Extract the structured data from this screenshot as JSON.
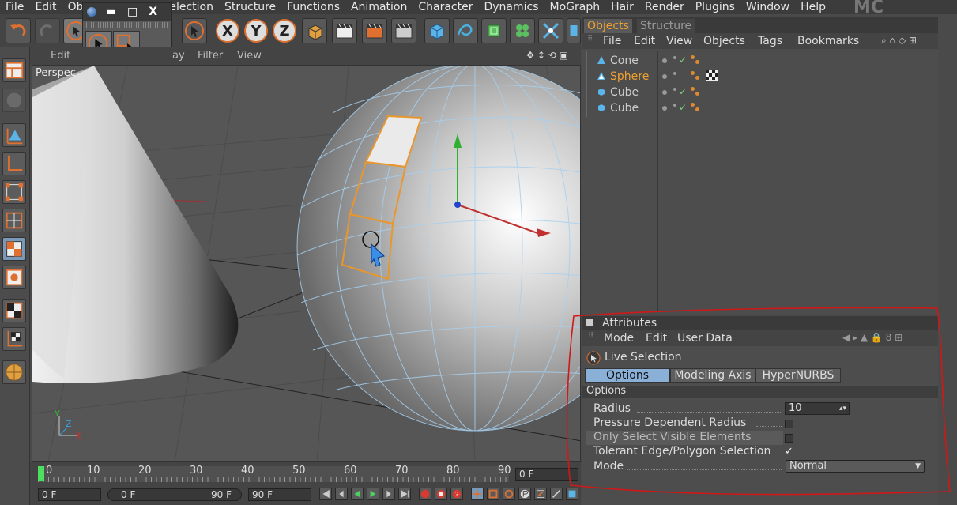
{
  "menubar": {
    "items": [
      "File",
      "Edit",
      "Ob",
      "Selection",
      "Structure",
      "Functions",
      "Animation",
      "Character",
      "Dynamics",
      "MoGraph",
      "Hair",
      "Render",
      "Plugins",
      "Window",
      "Help"
    ],
    "logo": "MC"
  },
  "palette": {
    "minimize": "▬",
    "maximize": "□",
    "close": "X"
  },
  "toolbar": {
    "axis_x": "X",
    "axis_y": "Y",
    "axis_z": "Z"
  },
  "viewport": {
    "menu": [
      "Edit",
      "ay",
      "Filter",
      "View"
    ],
    "label": "Perspec",
    "axis_labels": {
      "y": "Y",
      "z": "Z",
      "x": "X"
    }
  },
  "timeline": {
    "ticks": [
      "0",
      "10",
      "20",
      "30",
      "40",
      "50",
      "60",
      "70",
      "80",
      "90"
    ],
    "current_frame": "0 F",
    "start": "0 F",
    "range_start": "0 F",
    "range_end": "90 F",
    "end": "90 F"
  },
  "object_manager": {
    "tabs": [
      "Objects",
      "Structure"
    ],
    "menu": [
      "File",
      "Edit",
      "View",
      "Objects",
      "Tags",
      "Bookmarks"
    ],
    "objects": [
      {
        "name": "Cone",
        "selected": false
      },
      {
        "name": "Sphere",
        "selected": true
      },
      {
        "name": "Cube",
        "selected": false
      },
      {
        "name": "Cube",
        "selected": false
      }
    ],
    "selected_color": "#f0a030"
  },
  "attributes": {
    "title": "Attributes",
    "menu": [
      "Mode",
      "Edit",
      "User Data"
    ],
    "tool_name": "Live Selection",
    "tabs": [
      "Options",
      "Modeling Axis",
      "HyperNURBS"
    ],
    "section": "Options",
    "radius_label": "Radius",
    "radius_value": "10",
    "pressure_label": "Pressure Dependent Radius",
    "visible_label": "Only Select Visible Elements",
    "tolerant_label": "Tolerant Edge/Polygon Selection",
    "tolerant_check": "✓",
    "mode_label": "Mode",
    "mode_value": "Normal"
  }
}
